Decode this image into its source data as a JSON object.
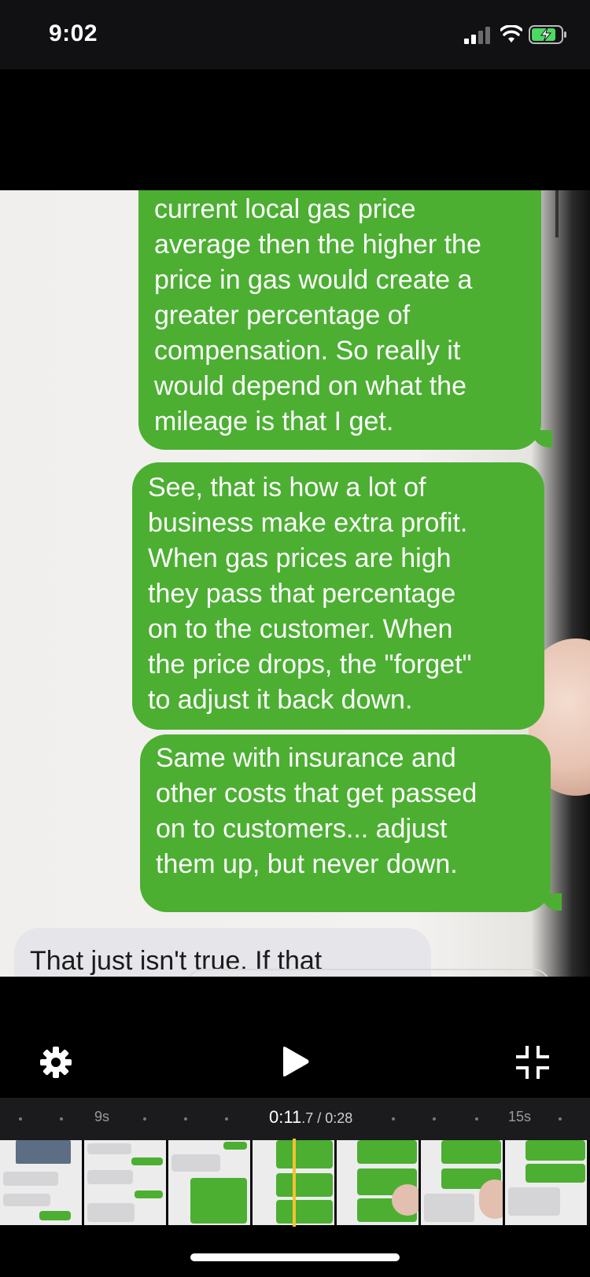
{
  "status_bar": {
    "time": "9:02",
    "icons": [
      "signal-icon",
      "wifi-icon",
      "battery-charging-icon"
    ]
  },
  "video": {
    "messages": [
      {
        "direction": "outgoing",
        "lines": [
          "current local gas price",
          "average then the higher the",
          "price in gas would create a",
          "greater percentage of",
          "compensation. So really it",
          "would depend on what the",
          "mileage is that I get."
        ]
      },
      {
        "direction": "outgoing",
        "lines": [
          "See, that is how a lot of",
          "business make extra profit.",
          "When gas prices are high",
          "they pass that percentage",
          "on to the customer.  When",
          "the price drops, the \"forget\"",
          "to adjust it back down."
        ]
      },
      {
        "direction": "outgoing",
        "lines": [
          "Same with insurance and",
          "other costs that get passed",
          "on to customers...  adjust",
          "them up, but never down."
        ]
      },
      {
        "direction": "incoming",
        "lines": [
          "That just isn't true. If that"
        ]
      }
    ],
    "colors": {
      "outgoing_bubble": "#4caf32",
      "incoming_bubble": "#e5e5ea"
    }
  },
  "controls": {
    "settings_icon": "gear-icon",
    "play_icon": "play-icon",
    "fullscreen_icon": "exit-fullscreen-icon"
  },
  "timeline": {
    "left_marker": "9s",
    "right_marker": "15s",
    "current_time_main": "0:11",
    "current_time_fraction": ".7",
    "separator": " / ",
    "duration": "0:28",
    "playhead_color": "#f2c230",
    "thumbnail_count": 7
  }
}
